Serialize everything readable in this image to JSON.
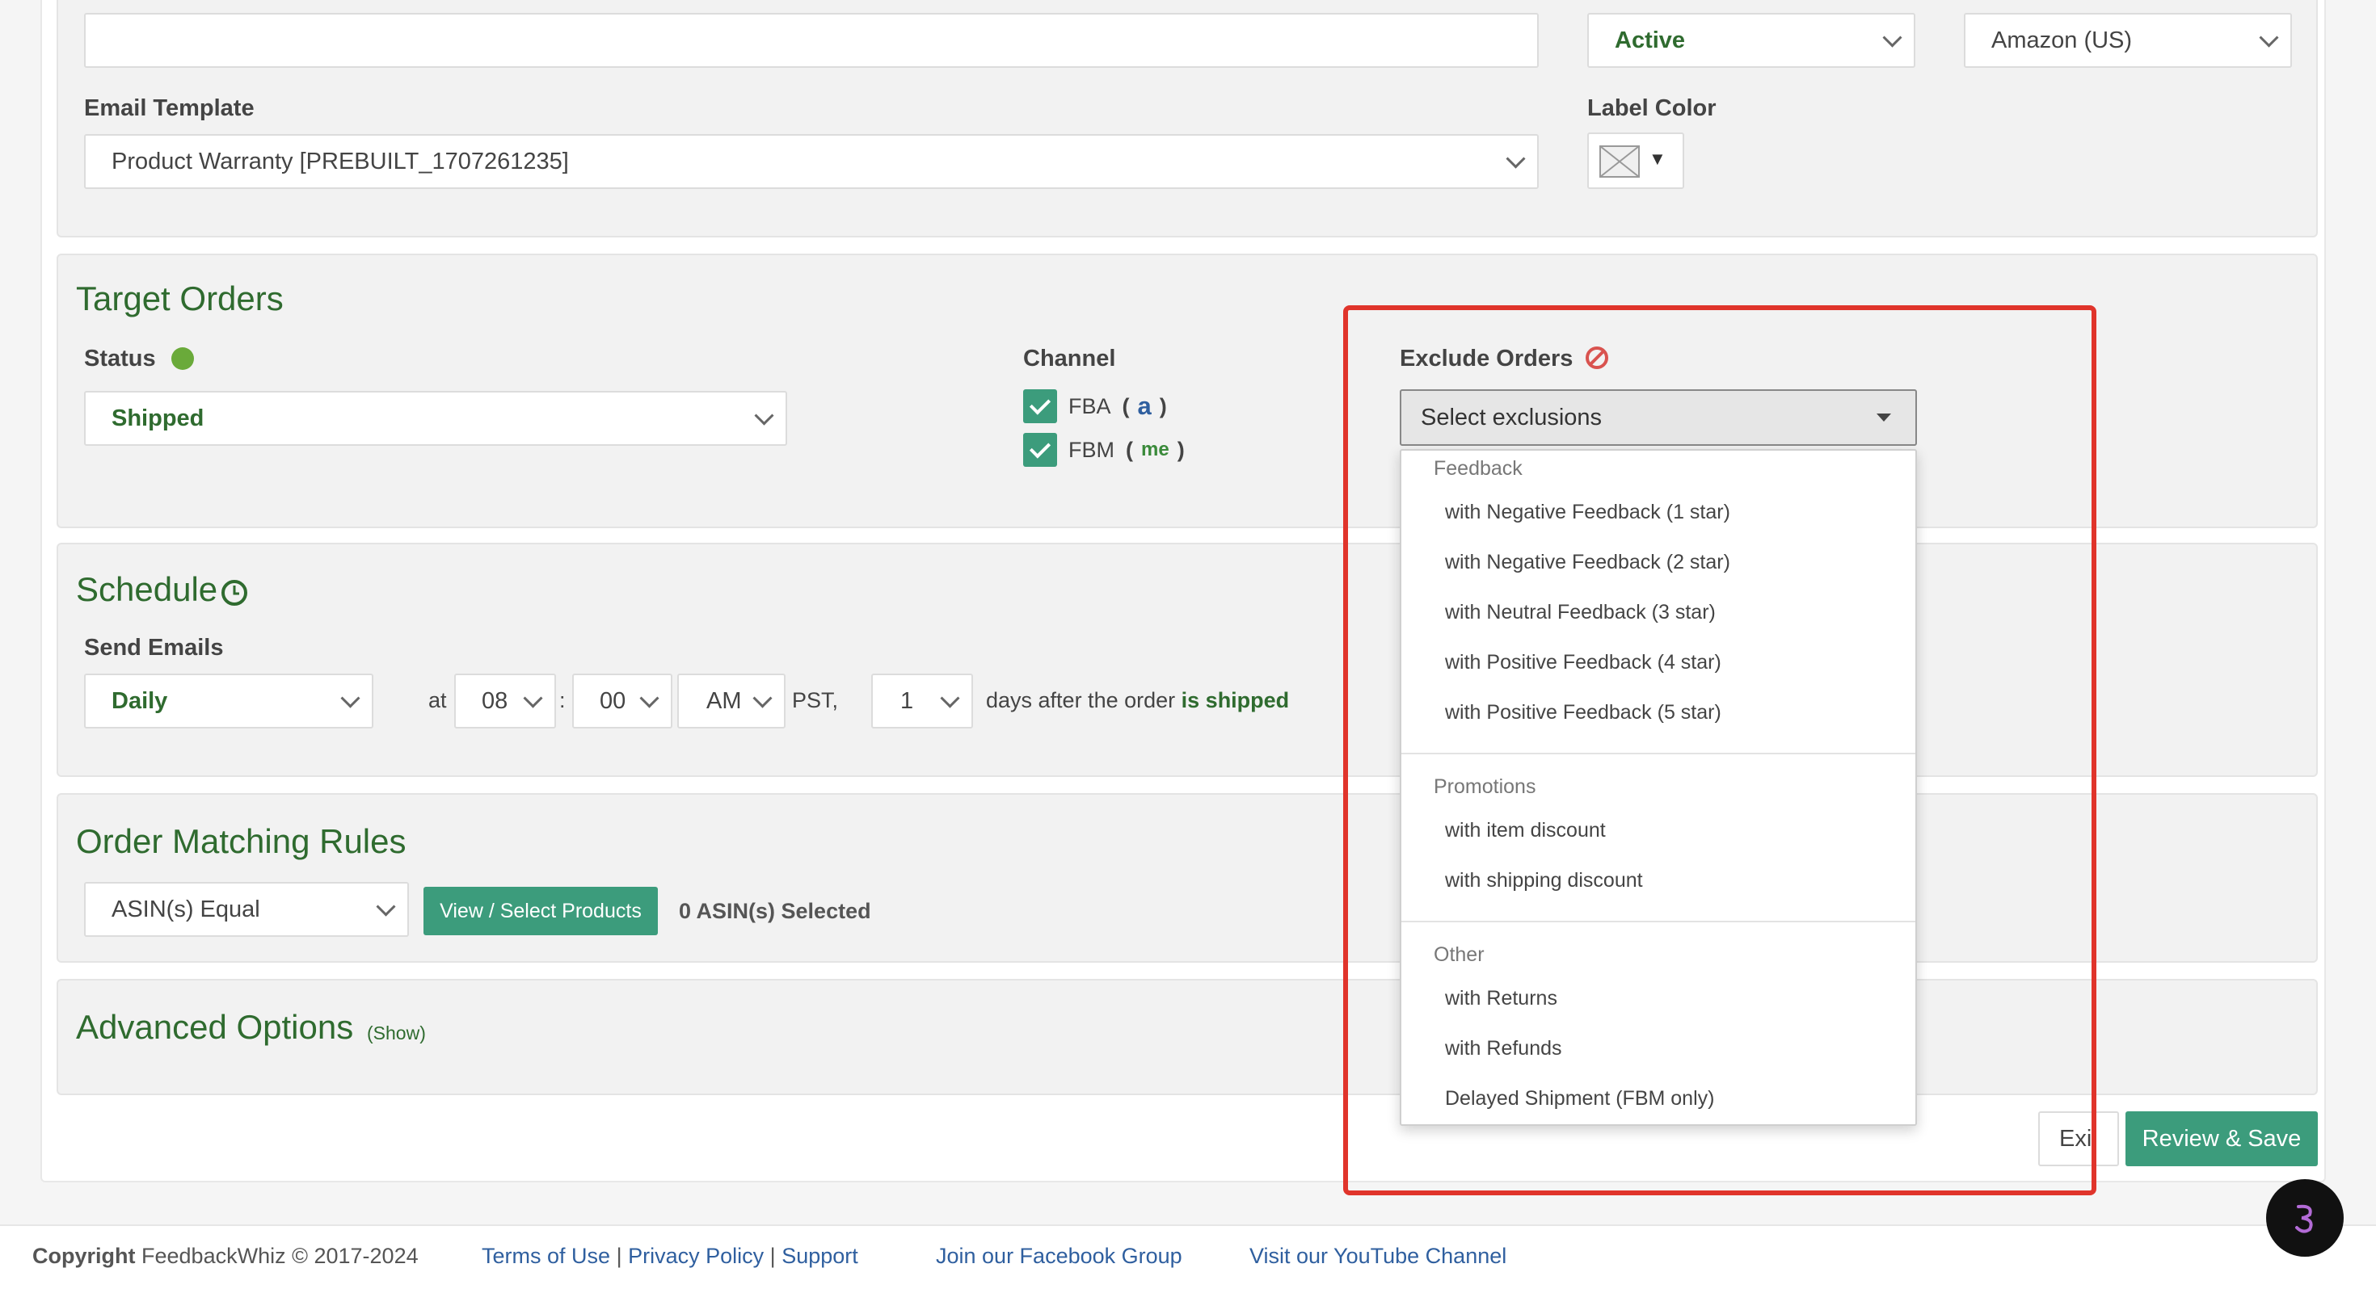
{
  "campaign": {
    "status_value": "Active",
    "marketplace_value": "Amazon (US)",
    "email_template_label": "Email Template",
    "email_template_value": "Product Warranty [PREBUILT_1707261235]",
    "label_color_label": "Label Color",
    "label_color_caret": "▼"
  },
  "target_orders": {
    "title": "Target Orders",
    "status_label": "Status",
    "status_value": "Shipped",
    "channel_label": "Channel",
    "channels": [
      {
        "label": "FBA",
        "paren_open": "(",
        "logo_text": "a",
        "paren_close": ")"
      },
      {
        "label": "FBM",
        "paren_open": "(",
        "logo_text": "me",
        "paren_close": ")"
      }
    ],
    "exclude_label": "Exclude Orders",
    "exclude_placeholder": "Select exclusions"
  },
  "exclusions_menu": {
    "groups": [
      {
        "label": "Feedback",
        "options": [
          "with Negative Feedback (1 star)",
          "with Negative Feedback (2 star)",
          "with Neutral Feedback (3 star)",
          "with Positive Feedback (4 star)",
          "with Positive Feedback (5 star)"
        ]
      },
      {
        "label": "Promotions",
        "options": [
          "with item discount",
          "with shipping discount"
        ]
      },
      {
        "label": "Other",
        "options": [
          "with Returns",
          "with Refunds",
          "Delayed Shipment (FBM only)"
        ]
      }
    ]
  },
  "schedule": {
    "title": "Schedule",
    "send_emails_label": "Send Emails",
    "frequency": "Daily",
    "at_label": "at",
    "hour": "08",
    "colon": ":",
    "minute": "00",
    "ampm": "AM",
    "timezone": "PST,",
    "days": "1",
    "days_after_text": "days after the order",
    "event_text": "is shipped"
  },
  "order_matching": {
    "title": "Order Matching Rules",
    "rule_value": "ASIN(s) Equal",
    "view_button": "View / Select Products",
    "selected_text": "0 ASIN(s) Selected"
  },
  "advanced": {
    "title": "Advanced Options",
    "toggle": "(Show)"
  },
  "actions": {
    "exit_label": "Exi",
    "save_label": "Review & Save"
  },
  "footer": {
    "copyright_bold": "Copyright",
    "copyright_text": "FeedbackWhiz © 2017-2024",
    "terms": "Terms of Use",
    "sep": "|",
    "privacy": "Privacy Policy",
    "support": "Support",
    "facebook": "Join our Facebook Group",
    "youtube": "Visit our YouTube Channel"
  },
  "colors": {
    "accent_green": "#3c9c7c",
    "title_green": "#2f6b2f",
    "status_dot": "#6aaa3a",
    "highlight_red": "#e0342b",
    "link_blue": "#2f5f9f"
  }
}
